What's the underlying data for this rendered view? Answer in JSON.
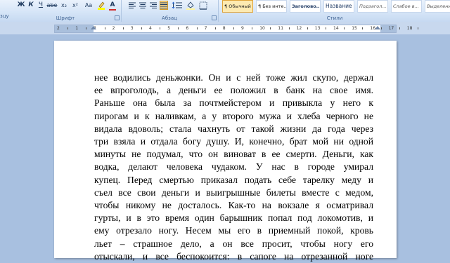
{
  "ribbon": {
    "left_fragment": "зцу",
    "font_group": {
      "label": "Шрифт",
      "bold": "Ж",
      "italic": "К",
      "underline": "Ч",
      "strike": "abe",
      "subscript": "x₂",
      "superscript": "x²",
      "change_case": "Aa",
      "highlight_icon": "highlighter-icon",
      "font_color": "A",
      "font_color_value": "#d12a2a",
      "highlight_color_value": "#ffff00"
    },
    "paragraph_group": {
      "label": "Абзац",
      "sort": "¶"
    },
    "styles_group": {
      "label": "Стили",
      "styles": [
        {
          "preview": "¶ Обычный",
          "active": true
        },
        {
          "preview": "¶ Без инте...",
          "active": false
        },
        {
          "preview": "Заголово...",
          "active": false
        },
        {
          "preview": "Название",
          "active": false
        },
        {
          "preview": "Подзагол...",
          "active": false
        },
        {
          "preview": "Слабое в...",
          "active": false
        },
        {
          "preview": "Выделение",
          "active": false
        }
      ]
    }
  },
  "ruler": {
    "numbers": [
      "2",
      "1",
      "1",
      "2",
      "3",
      "4",
      "5",
      "6",
      "7",
      "8",
      "9",
      "10",
      "11",
      "12",
      "13",
      "14",
      "15",
      "16",
      "17",
      "18"
    ]
  },
  "document": {
    "lines": [
      "нее водились деньжонки. Он и с ней тоже жил скупо, держал",
      "ее впроголодь, а деньги ее положил в банк на свое имя.",
      "Раньше она была за почтмейстером и привыкла у него к",
      "пирогам и к наливкам, а у второго мужа и хлеба черного не",
      "видала вдоволь; стала чахнуть от такой жизни да года через",
      "три взяла и отдала богу душу. И, конечно, брат мой ни одной",
      "минуты не подумал, что он виноват в ее смерти. Деньги, как",
      "водка, делают человека чудаком. У нас в городе умирал",
      "купец. Перед смертью приказал подать себе тарелку меду и",
      "съел все свои деньги и выигрышные билеты вместе с медом,",
      "чтобы никому не досталось. Как-то на вокзале я осматривал",
      "гурты, и в это время один барышник попал под локомотив, и",
      "ему отрезало ногу. Несем мы его в приемный покой, кровь",
      "льет – страшное дело, а он все просит, чтобы ногу его",
      "отыскали, и все беспокоится: в сапоге на отрезанной ноге"
    ]
  }
}
